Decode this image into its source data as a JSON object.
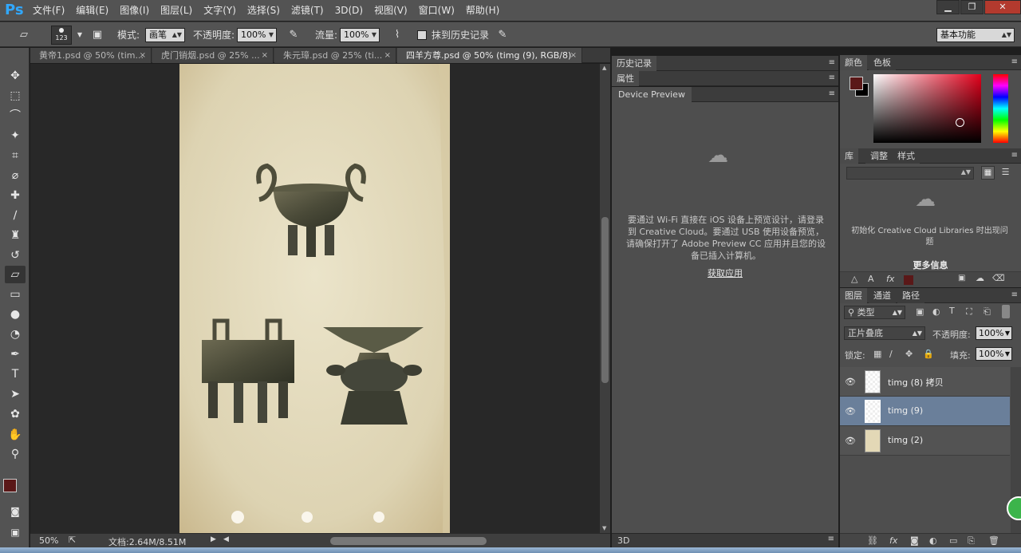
{
  "app": {
    "logo": "Ps"
  },
  "menu": [
    "文件(F)",
    "编辑(E)",
    "图像(I)",
    "图层(L)",
    "文字(Y)",
    "选择(S)",
    "滤镜(T)",
    "3D(D)",
    "视图(V)",
    "窗口(W)",
    "帮助(H)"
  ],
  "window_controls": {
    "minimize": "▁",
    "restore": "❐",
    "close": "✕"
  },
  "options": {
    "brush_size": "123",
    "mode_label": "模式:",
    "mode_value": "画笔",
    "opacity_label": "不透明度:",
    "opacity_value": "100%",
    "flow_label": "流量:",
    "flow_value": "100%",
    "erase_history_label": "抹到历史记录",
    "workspace": "基本功能"
  },
  "tabs": [
    {
      "label": "黄帝1.psd @ 50% (tim...",
      "close": "×"
    },
    {
      "label": "虎门销烟.psd @ 25% ...",
      "close": "×"
    },
    {
      "label": "朱元璋.psd @ 25% (ti...",
      "close": "×"
    },
    {
      "label": "四羊方尊.psd @ 50% (timg (9), RGB/8)",
      "close": "×"
    }
  ],
  "status": {
    "zoom": "50%",
    "doc": "文档:2.64M/8.51M"
  },
  "panels": {
    "history": "历史记录",
    "properties": "属性",
    "device_preview": "Device Preview",
    "device_msg": "要通过 Wi-Fi 直接在 iOS 设备上预览设计，请登录到 Creative Cloud。要通过 USB 使用设备预览，请确保打开了 Adobe Preview CC 应用并且您的设备已插入计算机。",
    "get_app": "获取应用",
    "three_d": "3D",
    "color_tab": "颜色",
    "swatches_tab": "色板",
    "library_tab": "库",
    "adjust_tab": "调整",
    "style_tab": "样式",
    "lib_msg": "初始化 Creative Cloud Libraries 时出现问题",
    "more_info": "更多信息",
    "layers_tab": "图层",
    "channels_tab": "通道",
    "paths_tab": "路径",
    "filter_kind": "类型",
    "blend_mode": "正片叠底",
    "layer_opacity_label": "不透明度:",
    "layer_opacity": "100%",
    "lock_label": "锁定:",
    "fill_label": "填充:",
    "fill_value": "100%"
  },
  "layers": [
    {
      "name": "timg (8) 拷贝",
      "selected": false
    },
    {
      "name": "timg (9)",
      "selected": true
    },
    {
      "name": "timg (2)",
      "selected": false
    }
  ],
  "colors": {
    "foreground": "#5a1818",
    "background": "#000000",
    "accent": "#31a8ff"
  }
}
